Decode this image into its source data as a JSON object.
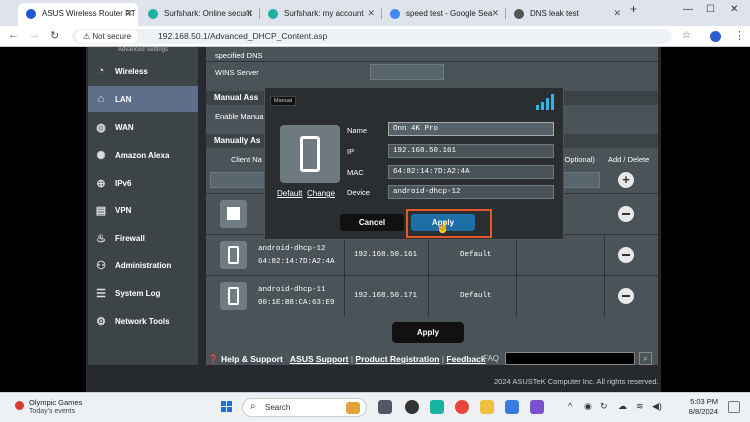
{
  "browser": {
    "tabs": [
      {
        "title": "ASUS Wireless Router RT",
        "active": true,
        "favicon_color": "#2157d6"
      },
      {
        "title": "Surfshark: Online securit",
        "active": false,
        "favicon_color": "#17b3a3"
      },
      {
        "title": "Surfshark: my account",
        "active": false,
        "favicon_color": "#17b3a3"
      },
      {
        "title": "speed test - Google Sea",
        "active": false,
        "favicon_color": "#4285f4"
      },
      {
        "title": "DNS leak test",
        "active": false,
        "favicon_color": "#555555"
      }
    ],
    "new_tab": "+",
    "security_label": "Not secure",
    "url": "192.168.50.1/Advanced_DHCP_Content.asp"
  },
  "sidebar": {
    "heading": "Advanced Settings",
    "items": [
      {
        "label": "Wireless",
        "icon": "wifi-icon"
      },
      {
        "label": "LAN",
        "icon": "home-icon",
        "active": true
      },
      {
        "label": "WAN",
        "icon": "globe-icon"
      },
      {
        "label": "Amazon Alexa",
        "icon": "alexa-icon"
      },
      {
        "label": "IPv6",
        "icon": "ipv6-icon"
      },
      {
        "label": "VPN",
        "icon": "vpn-icon"
      },
      {
        "label": "Firewall",
        "icon": "firewall-icon"
      },
      {
        "label": "Administration",
        "icon": "admin-icon"
      },
      {
        "label": "System Log",
        "icon": "log-icon"
      },
      {
        "label": "Network Tools",
        "icon": "tools-icon"
      }
    ]
  },
  "main": {
    "row_specified_dns": "specified DNS",
    "row_wins_server": "WINS Server",
    "section_manual": "Manual Ass",
    "row_enable_manual": "Enable Manua",
    "section_manually": "Manually As",
    "col_client_name": "Client Na",
    "col_optional": "(Optional)",
    "col_add_delete": "Add / Delete",
    "rows": [
      {
        "name": "",
        "mac": "",
        "ip": "",
        "dns": ""
      },
      {
        "name": "android-dhcp-12",
        "mac": "64:82:14:7D:A2:4A",
        "ip": "192.168.50.161",
        "dns": "Default"
      },
      {
        "name": "android-dhcp-11",
        "mac": "00:1E:B8:CA:63:E9",
        "ip": "192.168.50.171",
        "dns": "Default"
      }
    ],
    "apply_label": "Apply",
    "help_support": "Help & Support",
    "asus_support": "ASUS Support",
    "product_registration": "Product Registration",
    "feedback": "Feedback",
    "faq": "FAQ",
    "copyright": "2024 ASUSTeK Computer Inc. All rights reserved."
  },
  "modal": {
    "tag": "Manual",
    "default_link": "Default",
    "change_link": "Change",
    "fields": {
      "name_label": "Name",
      "name_value": "Onn 4K Pro",
      "ip_label": "IP",
      "ip_value": "192.168.50.161",
      "mac_label": "MAC",
      "mac_value": "64:82:14:7D:A2:4A",
      "device_label": "Device",
      "device_value": "android-dhcp-12"
    },
    "cancel_label": "Cancel",
    "apply_label": "Apply",
    "highlight_color": "#e2582a"
  },
  "taskbar": {
    "weather_title": "Olympic Games",
    "weather_sub": "Today's events",
    "search_placeholder": "Search",
    "time": "5:03 PM",
    "date": "8/8/2024"
  }
}
